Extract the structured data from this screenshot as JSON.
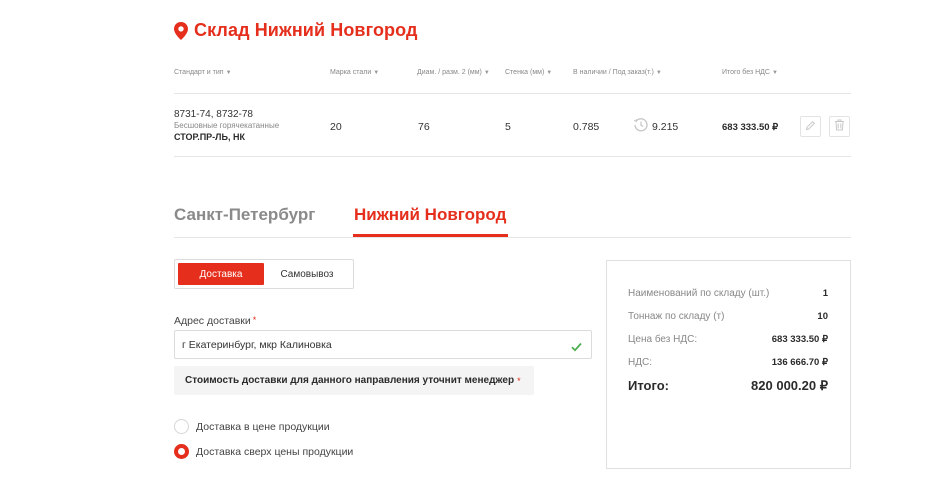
{
  "warehouse": {
    "title": "Склад Нижний Новгород"
  },
  "table": {
    "headers": [
      "Стандарт и тип",
      "Марка стали",
      "Диам. / разм. 2 (мм)",
      "Стенка (мм)",
      "В наличии / Под заказ(т.)",
      "Итого без НДС"
    ],
    "row": {
      "standard": "8731-74, 8732-78",
      "type": "Бесшовные горячекатанные",
      "name": "СТОР.ПР-ЛЬ, НК",
      "steel": "20",
      "diameter": "76",
      "wall": "5",
      "in_stock": "0.785",
      "on_order": "9.215",
      "total": "683 333.50 ₽"
    }
  },
  "city_tabs": [
    {
      "label": "Санкт-Петербург",
      "active": false
    },
    {
      "label": "Нижний Новгород",
      "active": true
    }
  ],
  "delivery": {
    "toggle": {
      "delivery_label": "Доставка",
      "pickup_label": "Самовывоз",
      "selected": "Доставка"
    },
    "address_label": "Адрес доставки",
    "required_mark": "*",
    "address_value": "г Екатеринбург, мкр Калиновка",
    "note": "Стоимость доставки для данного направления уточнит менеджер",
    "options": [
      {
        "label": "Доставка в цене продукции",
        "checked": false
      },
      {
        "label": "Доставка сверх цены продукции",
        "checked": true
      }
    ]
  },
  "summary": {
    "rows": [
      {
        "label": "Наименований по складу (шт.)",
        "value": "1"
      },
      {
        "label": "Тоннаж по складу (т)",
        "value": "10"
      },
      {
        "label": "Цена без НДС:",
        "value": "683 333.50 ₽"
      },
      {
        "label": "НДС:",
        "value": "136 666.70 ₽"
      }
    ],
    "total_label": "Итого:",
    "total_value": "820 000.20 ₽"
  },
  "colors": {
    "accent": "#e52e1c",
    "muted": "#888888"
  },
  "icons": [
    "location-pin-icon",
    "sort-caret-icon",
    "clock-icon",
    "edit-icon",
    "delete-icon",
    "checkmark-icon"
  ]
}
